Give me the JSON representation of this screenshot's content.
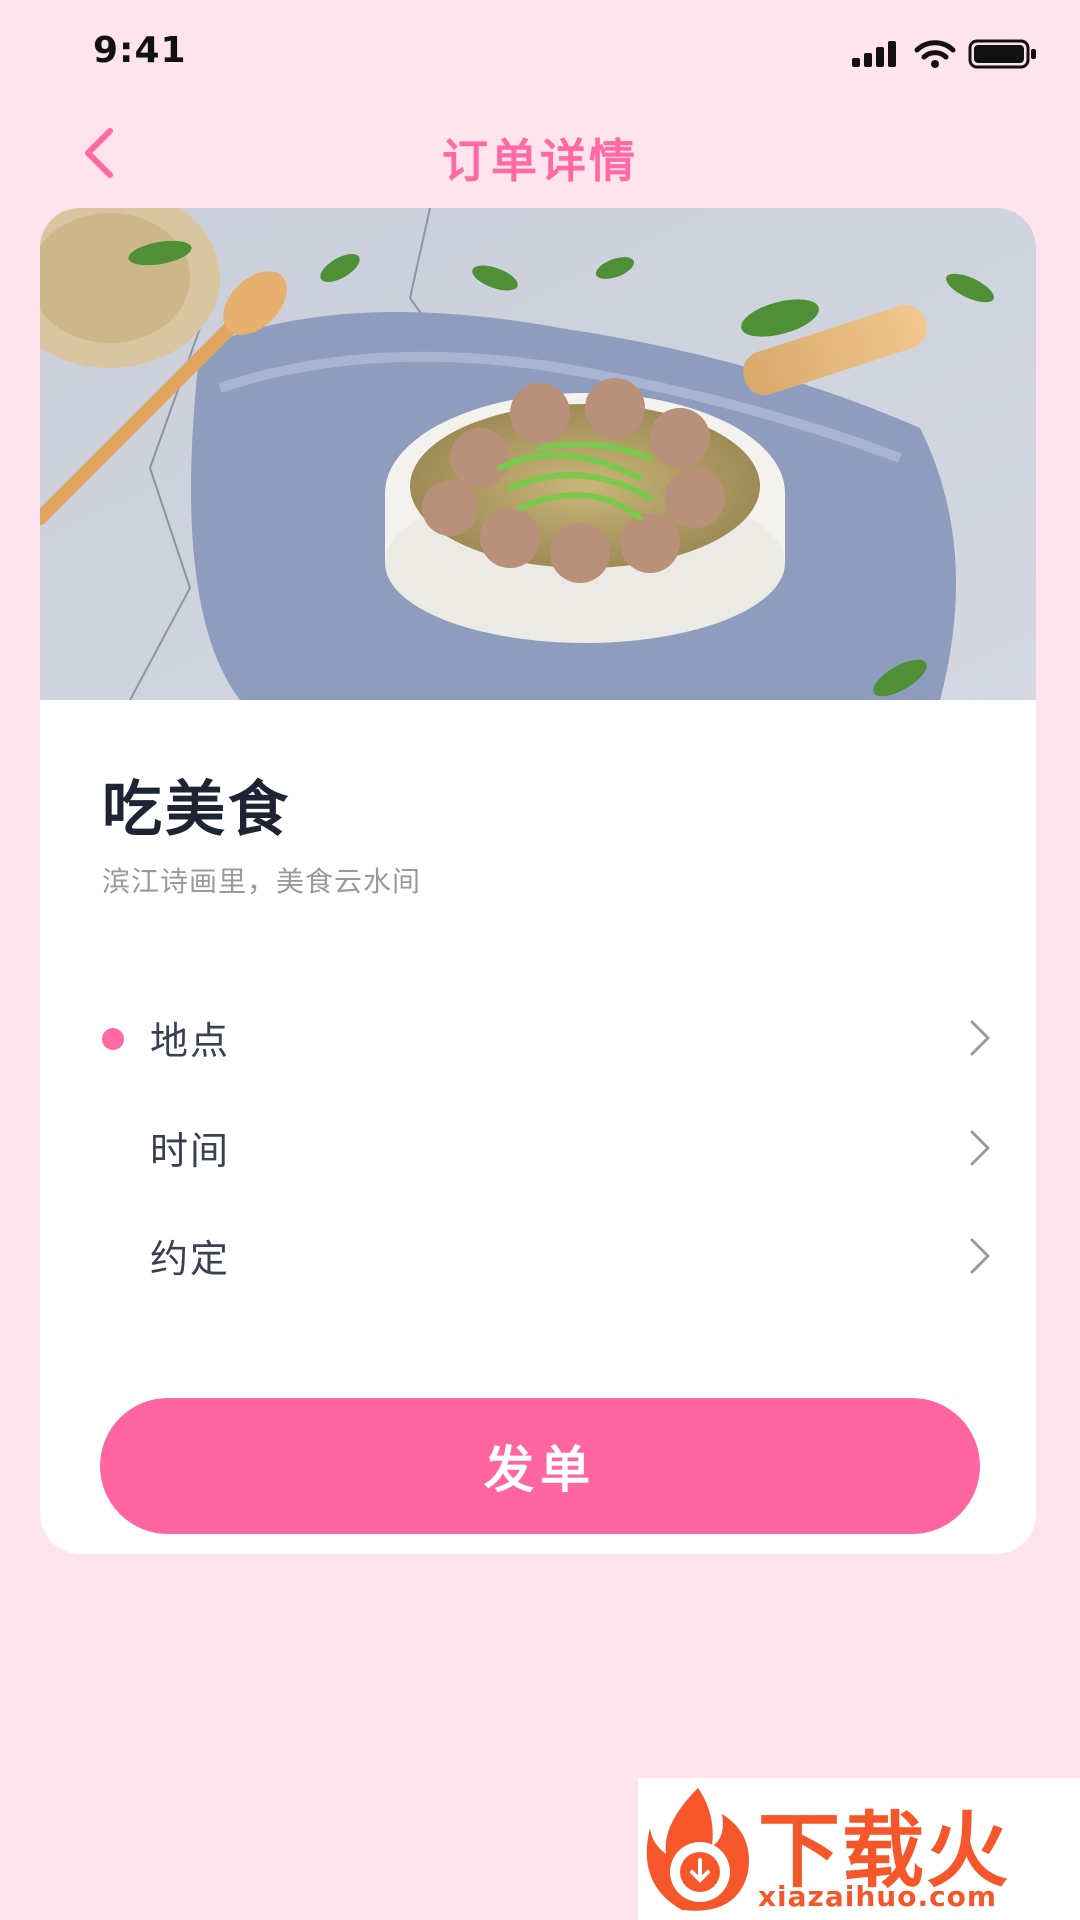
{
  "status_bar": {
    "time": "9:41",
    "icons": [
      "cellular-signal-icon",
      "wifi-icon",
      "battery-icon"
    ]
  },
  "header": {
    "back_icon": "chevron-left-icon",
    "title": "订单详情"
  },
  "card": {
    "hero_image": "meatball-noodle-soup-photo",
    "title": "吃美食",
    "subtitle": "滨江诗画里，美食云水间",
    "options": [
      {
        "label": "地点",
        "active": true
      },
      {
        "label": "时间",
        "active": false
      },
      {
        "label": "约定",
        "active": false
      }
    ],
    "submit_label": "发单"
  },
  "watermark": {
    "text": "下载火",
    "url": "xiazaihuo.com"
  },
  "colors": {
    "background": "#FFE4EE",
    "accent": "#FF66A1",
    "title_text": "#1E2433",
    "subtitle_text": "#9A9A9A",
    "watermark": "#F5572A"
  }
}
